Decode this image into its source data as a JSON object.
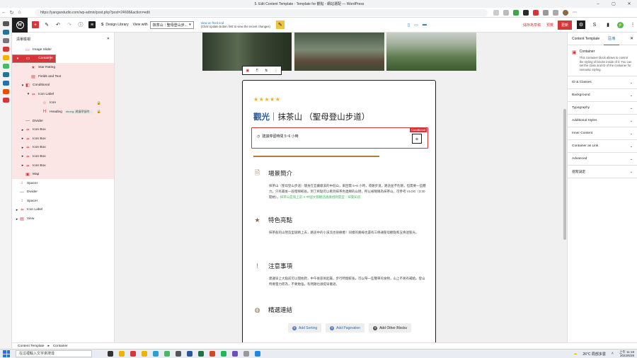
{
  "browser": {
    "window_title": "5. Edit Content Template - Template for 觀點 - 網站選配 — WordPress",
    "url": "https://yangarstudio.com/wp-admin/post.php?post=24608&action=edit"
  },
  "editor": {
    "design_library": "Design Library",
    "view_with_label": "View with",
    "view_with_value": "抹茶山｜聖母登山步...",
    "hint_line1": "View on front end",
    "hint_line2": "(Click Update button first to view the recent changes)",
    "save_draft": "儲存為草稿",
    "preview": "預覽",
    "update": "更新"
  },
  "list_view": {
    "title": "清單檢視",
    "items": [
      {
        "label": "Image Slider",
        "icon": "▭",
        "level": 1,
        "state": "plain",
        "caret": ""
      },
      {
        "label": "Container",
        "icon": "▭",
        "level": 0,
        "state": "selected",
        "caret": "▾"
      },
      {
        "label": "Star Rating",
        "icon": "★",
        "level": 2,
        "state": "child",
        "caret": ""
      },
      {
        "label": "Fields and Text",
        "icon": "▤",
        "level": 2,
        "state": "child",
        "caret": ""
      },
      {
        "label": "Conditional",
        "icon": "◧",
        "level": 1,
        "state": "child",
        "caret": "▾"
      },
      {
        "label": "Icon Label",
        "icon": "⇸",
        "level": 2,
        "state": "child",
        "caret": "▾"
      },
      {
        "label": "Icon",
        "icon": "☆",
        "level": 4,
        "state": "child",
        "caret": "",
        "lock": true
      },
      {
        "label": "Heading",
        "icon": "H",
        "level": 4,
        "state": "child",
        "caret": "",
        "chip": "strong: 建議停留時...",
        "lock": true
      },
      {
        "label": "Divider",
        "icon": "—",
        "level": 1,
        "state": "child",
        "caret": ""
      },
      {
        "label": "Icon Box",
        "icon": "⇸",
        "level": 1,
        "state": "child",
        "caret": "▸"
      },
      {
        "label": "Icon Box",
        "icon": "⇸",
        "level": 1,
        "state": "child",
        "caret": "▸"
      },
      {
        "label": "Icon Box",
        "icon": "⇸",
        "level": 1,
        "state": "child",
        "caret": "▸"
      },
      {
        "label": "Icon Box",
        "icon": "⇸",
        "level": 1,
        "state": "child",
        "caret": "▸"
      },
      {
        "label": "Icon Box",
        "icon": "⇸",
        "level": 1,
        "state": "child",
        "caret": "▸"
      },
      {
        "label": "Map",
        "icon": "▣",
        "level": 1,
        "state": "child",
        "caret": ""
      },
      {
        "label": "Spacer",
        "icon": "↕",
        "level": 0,
        "state": "plain",
        "caret": ""
      },
      {
        "label": "Divider",
        "icon": "—",
        "level": 0,
        "state": "plain",
        "caret": ""
      },
      {
        "label": "Spacer",
        "icon": "↕",
        "level": 0,
        "state": "plain",
        "caret": ""
      },
      {
        "label": "Icon Label",
        "icon": "⇸",
        "level": 0,
        "state": "plain",
        "caret": "▸"
      },
      {
        "label": "View",
        "icon": "▤",
        "level": 0,
        "state": "plain",
        "caret": "▸"
      }
    ]
  },
  "card": {
    "stars": "★★★★★",
    "title_kw": "觀光",
    "title_rest": "｜抹茶山 （聖母登山步道）",
    "time": "建議停留時間 5~6 小時",
    "cond_badge": "Conditional",
    "sections": [
      {
        "icon": "🗎",
        "heading": "場景簡介",
        "body": "抹茶山（聖母登山步道）隱身在宜蘭礁溪的中低山，來回需 5~6 小時，導路步道，路途並不危險，但需要一些體力，只有最後一段階梯較長。到了終點可以看到抹茶色連綿的山巒，所以被暱稱為抹茶山，可參考 VLOG（3:30 開始）。",
        "link": "抹茶山是雨上前 X 中國文都觀話通廣相間雲型｜抹葉知道"
      },
      {
        "icon": "★",
        "heading": "特色亮點",
        "body": "抹茶般的山巒造型吸睛上去，路途中的小溪流也很療癒！同樣的路線也還有三條通聖母觀點和五條迷聖光。"
      },
      {
        "icon": "!",
        "heading": "注意事項",
        "body": "建議早上大點前可以開始爬，中午後容易起霧，步行時間較長，可以帶一些簡單的食物，山上不易有補給。登山時要量力而為，不要勉強，有問題也請提早撤退。"
      },
      {
        "icon": "◍",
        "heading": "精選連結",
        "body": ""
      }
    ],
    "buttons": [
      "Add Sorting",
      "Add Pagination",
      "Add Other Blocks"
    ]
  },
  "inspector": {
    "tabs": [
      "Content Template",
      "區塊"
    ],
    "block_name": "Container",
    "block_desc": "This container block allows to control the styling of blocks inside of it. You can set the class and ID of the container for semantic styling.",
    "panels": [
      "ID & Classes",
      "Background",
      "Typography",
      "Additional Styles",
      "Inner Content",
      "Container as Link",
      "Advanced",
      "進階設定"
    ]
  },
  "breadcrumb": [
    "Content Template",
    "Container"
  ],
  "taskbar": {
    "search": "在這裡輸入文字來搜尋",
    "weather": "26°C 局部多雲",
    "time": "上午 11:18",
    "date": "2022/6/28"
  }
}
